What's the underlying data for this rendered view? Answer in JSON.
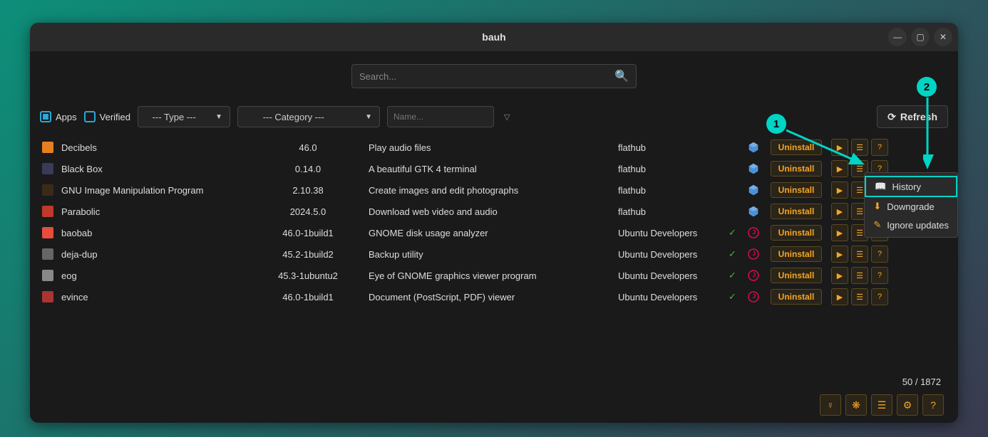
{
  "window": {
    "title": "bauh"
  },
  "search": {
    "placeholder": "Search..."
  },
  "filters": {
    "apps_label": "Apps",
    "verified_label": "Verified",
    "type_label": "--- Type ---",
    "category_label": "--- Category ---",
    "name_placeholder": "Name..."
  },
  "refresh_label": "Refresh",
  "action_label": "Uninstall",
  "apps": [
    {
      "icon_color": "#e67e22",
      "name": "Decibels",
      "version": "46.0",
      "desc": "Play audio files",
      "source": "flathub",
      "verified": "",
      "pkg_icon": "flatpak"
    },
    {
      "icon_color": "#3a3a5a",
      "name": "Black Box",
      "version": "0.14.0",
      "desc": "A beautiful GTK 4 terminal",
      "source": "flathub",
      "verified": "",
      "pkg_icon": "flatpak"
    },
    {
      "icon_color": "#3a2a1a",
      "name": "GNU Image Manipulation Program",
      "version": "2.10.38",
      "desc": "Create images and edit photographs",
      "source": "flathub",
      "verified": "",
      "pkg_icon": "flatpak"
    },
    {
      "icon_color": "#c0392b",
      "name": "Parabolic",
      "version": "2024.5.0",
      "desc": "Download web video and audio",
      "source": "flathub",
      "verified": "",
      "pkg_icon": "flatpak"
    },
    {
      "icon_color": "#e74c3c",
      "name": "baobab",
      "version": "46.0-1build1",
      "desc": "GNOME disk usage analyzer",
      "source": "Ubuntu Developers",
      "verified": "✓",
      "pkg_icon": "debian"
    },
    {
      "icon_color": "#666",
      "name": "deja-dup",
      "version": "45.2-1build2",
      "desc": "Backup utility",
      "source": "Ubuntu Developers",
      "verified": "✓",
      "pkg_icon": "debian"
    },
    {
      "icon_color": "#888",
      "name": "eog",
      "version": "45.3-1ubuntu2",
      "desc": "Eye of GNOME graphics viewer program",
      "source": "Ubuntu Developers",
      "verified": "✓",
      "pkg_icon": "debian"
    },
    {
      "icon_color": "#a33",
      "name": "evince",
      "version": "46.0-1build1",
      "desc": "Document (PostScript, PDF) viewer",
      "source": "Ubuntu Developers",
      "verified": "✓",
      "pkg_icon": "debian"
    }
  ],
  "counter": "50 / 1872",
  "context_menu": {
    "history": "History",
    "downgrade": "Downgrade",
    "ignore": "Ignore updates"
  },
  "annotations": {
    "one": "1",
    "two": "2"
  }
}
